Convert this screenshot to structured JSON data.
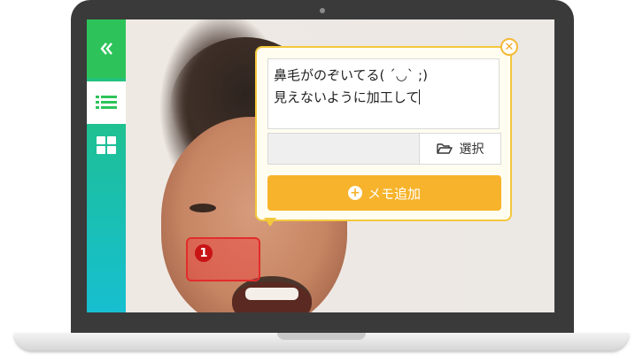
{
  "sidebar": {
    "collapse_icon": "double-chevron-left-icon",
    "list_icon": "list-icon",
    "grid_icon": "grid-icon",
    "accent": "#27c464"
  },
  "marker": {
    "number": "1"
  },
  "memo": {
    "text": "鼻毛がのぞいてる( ´◡` ;)\n見えないように加工して",
    "select_label": "選択",
    "add_label": "メモ追加",
    "accent": "#f7b32b"
  }
}
